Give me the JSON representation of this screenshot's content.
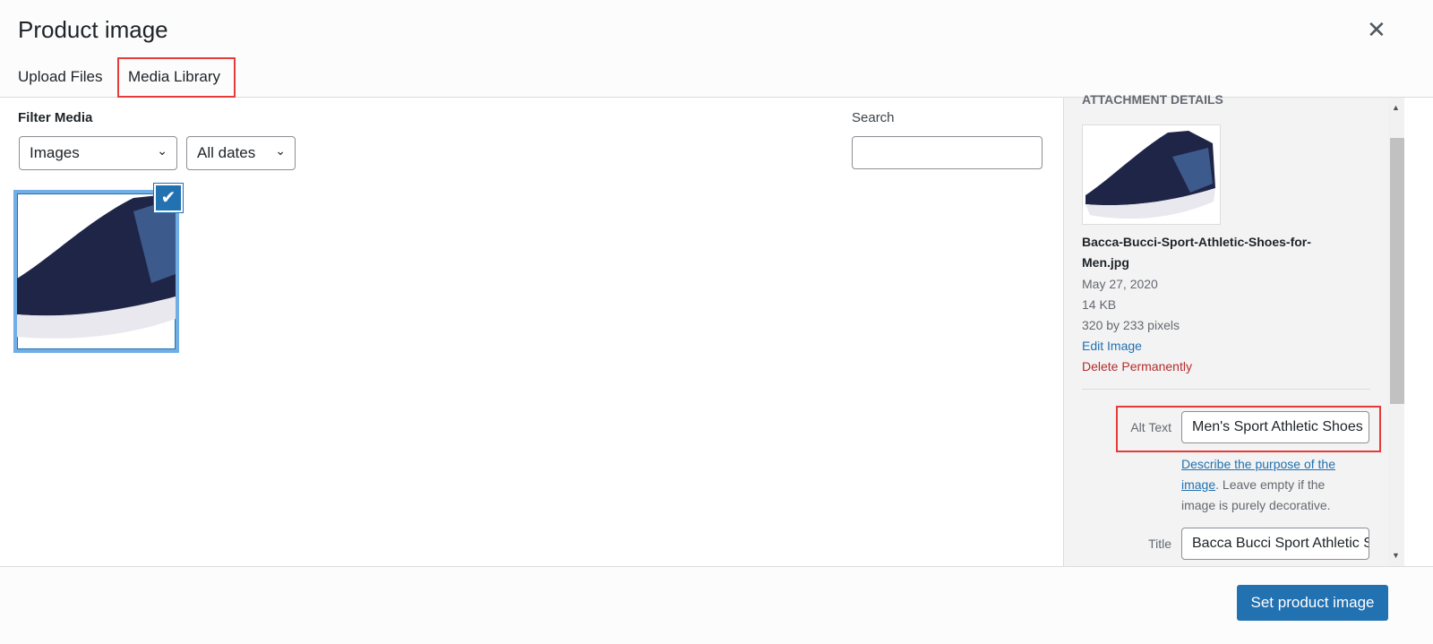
{
  "header": {
    "title": "Product image",
    "close_icon": "close-icon"
  },
  "tabs": [
    {
      "label": "Upload Files"
    },
    {
      "label": "Media Library",
      "active": true
    }
  ],
  "filter": {
    "label": "Filter Media",
    "type_select": "Images",
    "date_select": "All dates"
  },
  "search": {
    "label": "Search",
    "value": ""
  },
  "media_items": [
    {
      "selected": true,
      "alt": "Men's Sport Athletic Shoes"
    }
  ],
  "details": {
    "heading": "Attachment Details",
    "filename": "Bacca-Bucci-Sport-Athletic-Shoes-for-Men.jpg",
    "date": "May 27, 2020",
    "size": "14 KB",
    "dimensions": "320 by 233 pixels",
    "edit_link": "Edit Image",
    "delete_link": "Delete Permanently",
    "alt_label": "Alt Text",
    "alt_value": "Men's Sport Athletic Shoes",
    "help_link": "Describe the purpose of the image",
    "help_text": ". Leave empty if the image is purely decorative.",
    "title_label": "Title",
    "title_value": "Bacca Bucci Sport Athletic Shoes for Men"
  },
  "footer": {
    "button": "Set product image"
  },
  "colors": {
    "accent": "#2271b1",
    "delete": "#b32d2e",
    "highlight": "#e63b3b"
  }
}
